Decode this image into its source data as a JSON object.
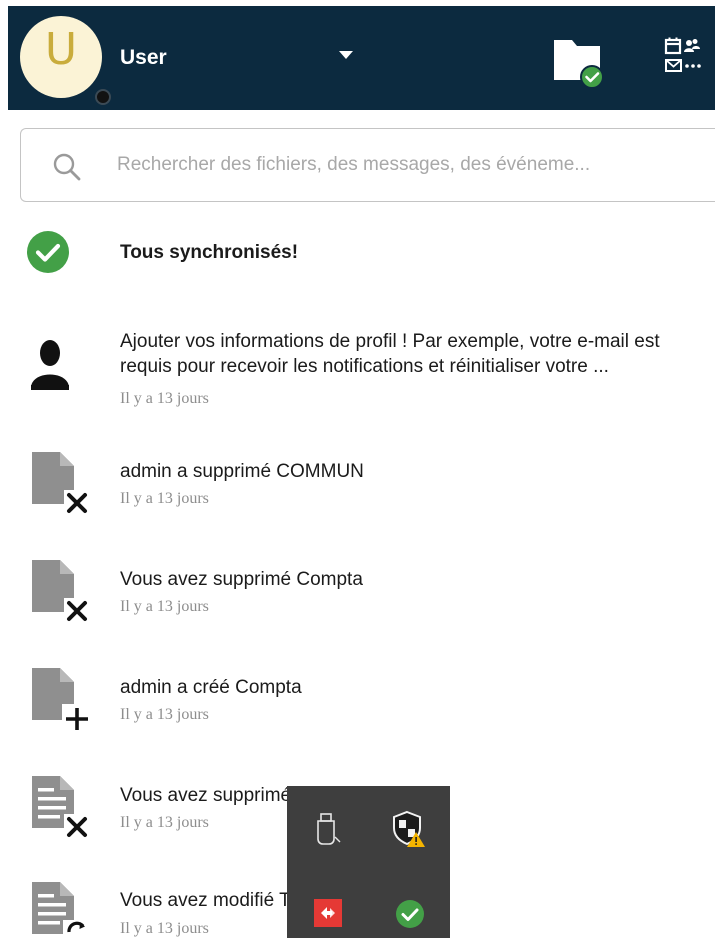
{
  "header": {
    "avatar_letter": "U",
    "user_name": "User",
    "bg_color": "#0c2a3f"
  },
  "search": {
    "placeholder": "Rechercher des fichiers, des messages, des événeme..."
  },
  "sync_status": {
    "label": "Tous synchronisés!",
    "icon": "check-circle-icon"
  },
  "activities": [
    {
      "icon": "person-icon",
      "text": "Ajouter vos informations de profil ! Par exemple, votre e-mail est requis pour recevoir les notifications et réinitialiser votre ...",
      "time": "Il y a 13 jours"
    },
    {
      "icon": "file-delete-icon",
      "text": "admin a supprimé COMMUN",
      "time": "Il y a 13 jours"
    },
    {
      "icon": "file-delete-icon",
      "text": "Vous avez supprimé Compta",
      "time": "Il y a 13 jours"
    },
    {
      "icon": "file-add-icon",
      "text": "admin a créé Compta",
      "time": "Il y a 13 jours"
    },
    {
      "icon": "text-file-delete-icon",
      "text": "Vous avez supprimé Test-Partage.md",
      "time": "Il y a 13 jours"
    },
    {
      "icon": "text-file-sync-icon",
      "text": "Vous avez modifié Test-Partage.md",
      "time": "Il y a 13 jours"
    }
  ],
  "tray": {
    "icons": [
      "usb-drive-icon",
      "security-warning-icon",
      "remote-access-icon",
      "sync-ok-icon"
    ]
  },
  "colors": {
    "accent_green": "#43a047",
    "timestamp_gray": "#8d8d8d",
    "tray_bg": "#3e3e3e"
  }
}
